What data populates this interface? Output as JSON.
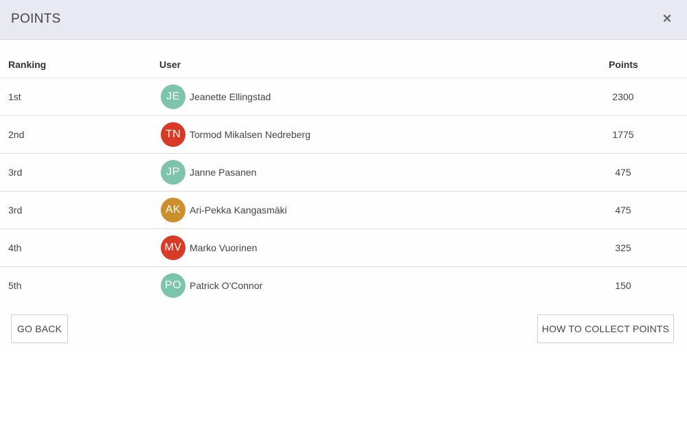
{
  "dialog": {
    "title": "POINTS",
    "close_label": "×"
  },
  "table": {
    "headers": {
      "ranking": "Ranking",
      "user": "User",
      "points": "Points"
    },
    "rows": [
      {
        "rank": "1st",
        "initials": "JE",
        "name": "Jeanette Ellingstad",
        "points": "2300",
        "avatar_color": "#7dc4ad"
      },
      {
        "rank": "2nd",
        "initials": "TN",
        "name": "Tormod Mikalsen Nedreberg",
        "points": "1775",
        "avatar_color": "#d83a26"
      },
      {
        "rank": "3rd",
        "initials": "JP",
        "name": "Janne Pasanen",
        "points": "475",
        "avatar_color": "#7dc4ad"
      },
      {
        "rank": "3rd",
        "initials": "AK",
        "name": "Ari-Pekka Kangasmäki",
        "points": "475",
        "avatar_color": "#cc8f2b"
      },
      {
        "rank": "4th",
        "initials": "MV",
        "name": "Marko Vuorinen",
        "points": "325",
        "avatar_color": "#d83a26"
      },
      {
        "rank": "5th",
        "initials": "PO",
        "name": "Patrick O'Connor",
        "points": "150",
        "avatar_color": "#7dc4ad"
      }
    ]
  },
  "footer": {
    "go_back_label": "GO BACK",
    "how_to_label": "HOW TO COLLECT POINTS"
  }
}
